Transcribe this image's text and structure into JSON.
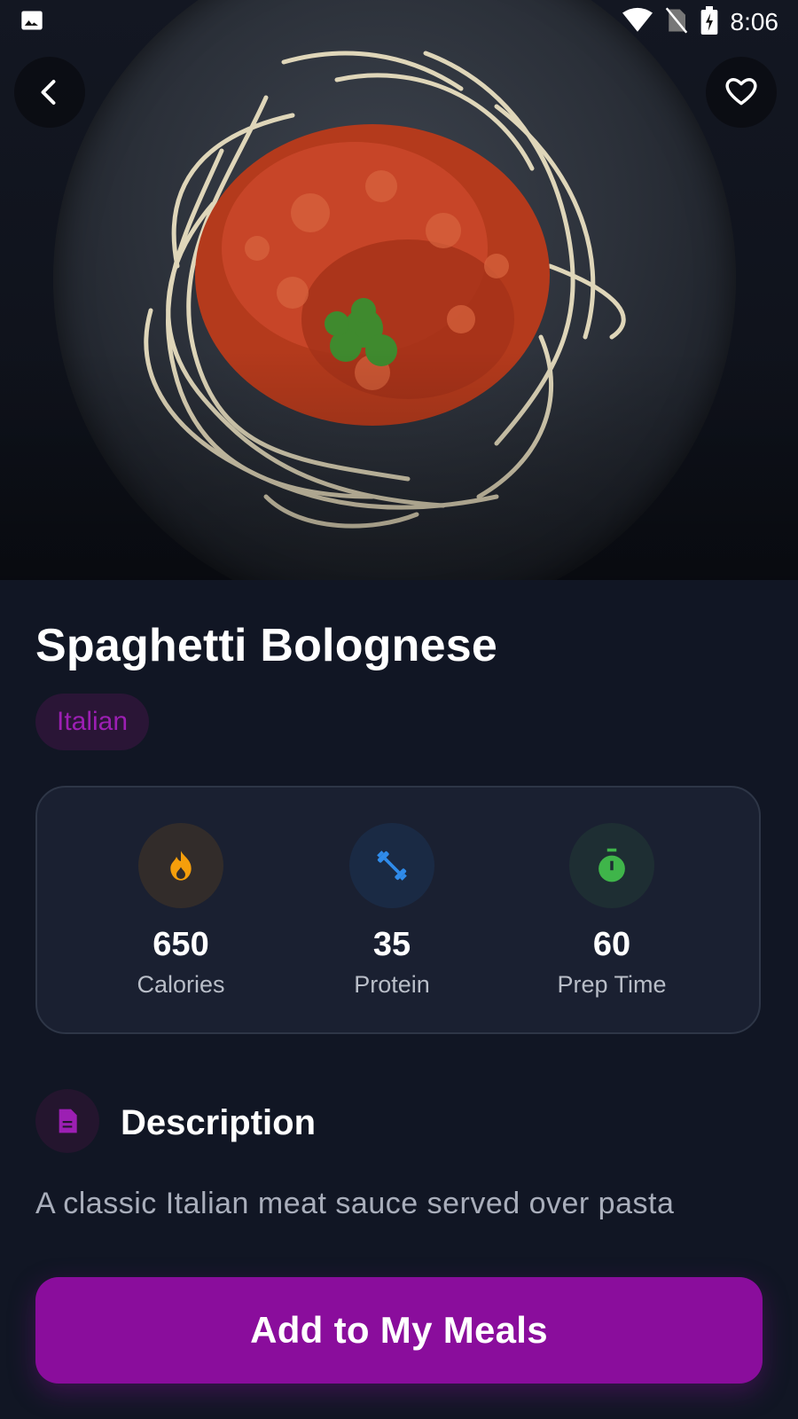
{
  "status_bar": {
    "time": "8:06"
  },
  "recipe": {
    "title": "Spaghetti Bolognese",
    "cuisine": "Italian",
    "stats": [
      {
        "value": "650",
        "label": "Calories",
        "icon": "fire-icon",
        "color": "#f59e0b"
      },
      {
        "value": "35",
        "label": "Protein",
        "icon": "dumbbell-icon",
        "color": "#2f8bea"
      },
      {
        "value": "60",
        "label": "Prep Time",
        "icon": "timer-icon",
        "color": "#3fb54a"
      }
    ]
  },
  "description": {
    "heading": "Description",
    "text": "A classic Italian meat sauce served over pasta"
  },
  "actions": {
    "add_label": "Add to My Meals"
  },
  "colors": {
    "background": "#111624",
    "card": "#1a2031",
    "accent": "#8a0d9c",
    "chip_text": "#9c1fb3"
  }
}
